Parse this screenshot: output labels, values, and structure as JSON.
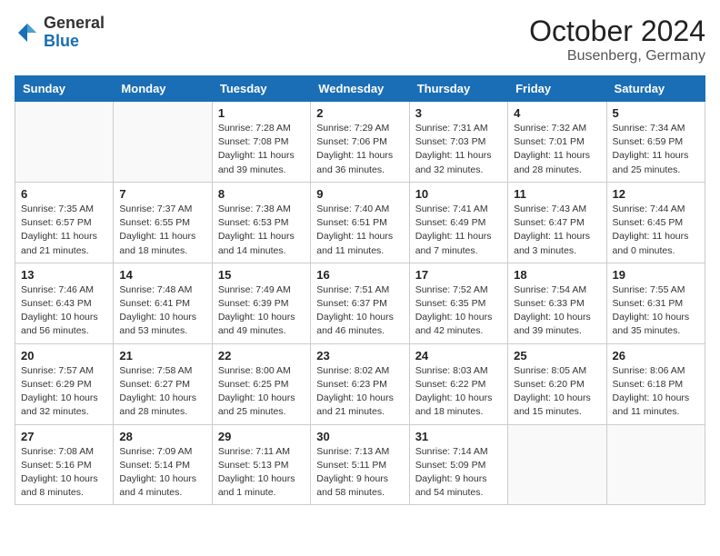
{
  "header": {
    "logo_general": "General",
    "logo_blue": "Blue",
    "month": "October 2024",
    "location": "Busenberg, Germany"
  },
  "columns": [
    "Sunday",
    "Monday",
    "Tuesday",
    "Wednesday",
    "Thursday",
    "Friday",
    "Saturday"
  ],
  "weeks": [
    [
      {
        "day": "",
        "sunrise": "",
        "sunset": "",
        "daylight": ""
      },
      {
        "day": "",
        "sunrise": "",
        "sunset": "",
        "daylight": ""
      },
      {
        "day": "1",
        "sunrise": "Sunrise: 7:28 AM",
        "sunset": "Sunset: 7:08 PM",
        "daylight": "Daylight: 11 hours and 39 minutes."
      },
      {
        "day": "2",
        "sunrise": "Sunrise: 7:29 AM",
        "sunset": "Sunset: 7:06 PM",
        "daylight": "Daylight: 11 hours and 36 minutes."
      },
      {
        "day": "3",
        "sunrise": "Sunrise: 7:31 AM",
        "sunset": "Sunset: 7:03 PM",
        "daylight": "Daylight: 11 hours and 32 minutes."
      },
      {
        "day": "4",
        "sunrise": "Sunrise: 7:32 AM",
        "sunset": "Sunset: 7:01 PM",
        "daylight": "Daylight: 11 hours and 28 minutes."
      },
      {
        "day": "5",
        "sunrise": "Sunrise: 7:34 AM",
        "sunset": "Sunset: 6:59 PM",
        "daylight": "Daylight: 11 hours and 25 minutes."
      }
    ],
    [
      {
        "day": "6",
        "sunrise": "Sunrise: 7:35 AM",
        "sunset": "Sunset: 6:57 PM",
        "daylight": "Daylight: 11 hours and 21 minutes."
      },
      {
        "day": "7",
        "sunrise": "Sunrise: 7:37 AM",
        "sunset": "Sunset: 6:55 PM",
        "daylight": "Daylight: 11 hours and 18 minutes."
      },
      {
        "day": "8",
        "sunrise": "Sunrise: 7:38 AM",
        "sunset": "Sunset: 6:53 PM",
        "daylight": "Daylight: 11 hours and 14 minutes."
      },
      {
        "day": "9",
        "sunrise": "Sunrise: 7:40 AM",
        "sunset": "Sunset: 6:51 PM",
        "daylight": "Daylight: 11 hours and 11 minutes."
      },
      {
        "day": "10",
        "sunrise": "Sunrise: 7:41 AM",
        "sunset": "Sunset: 6:49 PM",
        "daylight": "Daylight: 11 hours and 7 minutes."
      },
      {
        "day": "11",
        "sunrise": "Sunrise: 7:43 AM",
        "sunset": "Sunset: 6:47 PM",
        "daylight": "Daylight: 11 hours and 3 minutes."
      },
      {
        "day": "12",
        "sunrise": "Sunrise: 7:44 AM",
        "sunset": "Sunset: 6:45 PM",
        "daylight": "Daylight: 11 hours and 0 minutes."
      }
    ],
    [
      {
        "day": "13",
        "sunrise": "Sunrise: 7:46 AM",
        "sunset": "Sunset: 6:43 PM",
        "daylight": "Daylight: 10 hours and 56 minutes."
      },
      {
        "day": "14",
        "sunrise": "Sunrise: 7:48 AM",
        "sunset": "Sunset: 6:41 PM",
        "daylight": "Daylight: 10 hours and 53 minutes."
      },
      {
        "day": "15",
        "sunrise": "Sunrise: 7:49 AM",
        "sunset": "Sunset: 6:39 PM",
        "daylight": "Daylight: 10 hours and 49 minutes."
      },
      {
        "day": "16",
        "sunrise": "Sunrise: 7:51 AM",
        "sunset": "Sunset: 6:37 PM",
        "daylight": "Daylight: 10 hours and 46 minutes."
      },
      {
        "day": "17",
        "sunrise": "Sunrise: 7:52 AM",
        "sunset": "Sunset: 6:35 PM",
        "daylight": "Daylight: 10 hours and 42 minutes."
      },
      {
        "day": "18",
        "sunrise": "Sunrise: 7:54 AM",
        "sunset": "Sunset: 6:33 PM",
        "daylight": "Daylight: 10 hours and 39 minutes."
      },
      {
        "day": "19",
        "sunrise": "Sunrise: 7:55 AM",
        "sunset": "Sunset: 6:31 PM",
        "daylight": "Daylight: 10 hours and 35 minutes."
      }
    ],
    [
      {
        "day": "20",
        "sunrise": "Sunrise: 7:57 AM",
        "sunset": "Sunset: 6:29 PM",
        "daylight": "Daylight: 10 hours and 32 minutes."
      },
      {
        "day": "21",
        "sunrise": "Sunrise: 7:58 AM",
        "sunset": "Sunset: 6:27 PM",
        "daylight": "Daylight: 10 hours and 28 minutes."
      },
      {
        "day": "22",
        "sunrise": "Sunrise: 8:00 AM",
        "sunset": "Sunset: 6:25 PM",
        "daylight": "Daylight: 10 hours and 25 minutes."
      },
      {
        "day": "23",
        "sunrise": "Sunrise: 8:02 AM",
        "sunset": "Sunset: 6:23 PM",
        "daylight": "Daylight: 10 hours and 21 minutes."
      },
      {
        "day": "24",
        "sunrise": "Sunrise: 8:03 AM",
        "sunset": "Sunset: 6:22 PM",
        "daylight": "Daylight: 10 hours and 18 minutes."
      },
      {
        "day": "25",
        "sunrise": "Sunrise: 8:05 AM",
        "sunset": "Sunset: 6:20 PM",
        "daylight": "Daylight: 10 hours and 15 minutes."
      },
      {
        "day": "26",
        "sunrise": "Sunrise: 8:06 AM",
        "sunset": "Sunset: 6:18 PM",
        "daylight": "Daylight: 10 hours and 11 minutes."
      }
    ],
    [
      {
        "day": "27",
        "sunrise": "Sunrise: 7:08 AM",
        "sunset": "Sunset: 5:16 PM",
        "daylight": "Daylight: 10 hours and 8 minutes."
      },
      {
        "day": "28",
        "sunrise": "Sunrise: 7:09 AM",
        "sunset": "Sunset: 5:14 PM",
        "daylight": "Daylight: 10 hours and 4 minutes."
      },
      {
        "day": "29",
        "sunrise": "Sunrise: 7:11 AM",
        "sunset": "Sunset: 5:13 PM",
        "daylight": "Daylight: 10 hours and 1 minute."
      },
      {
        "day": "30",
        "sunrise": "Sunrise: 7:13 AM",
        "sunset": "Sunset: 5:11 PM",
        "daylight": "Daylight: 9 hours and 58 minutes."
      },
      {
        "day": "31",
        "sunrise": "Sunrise: 7:14 AM",
        "sunset": "Sunset: 5:09 PM",
        "daylight": "Daylight: 9 hours and 54 minutes."
      },
      {
        "day": "",
        "sunrise": "",
        "sunset": "",
        "daylight": ""
      },
      {
        "day": "",
        "sunrise": "",
        "sunset": "",
        "daylight": ""
      }
    ]
  ]
}
